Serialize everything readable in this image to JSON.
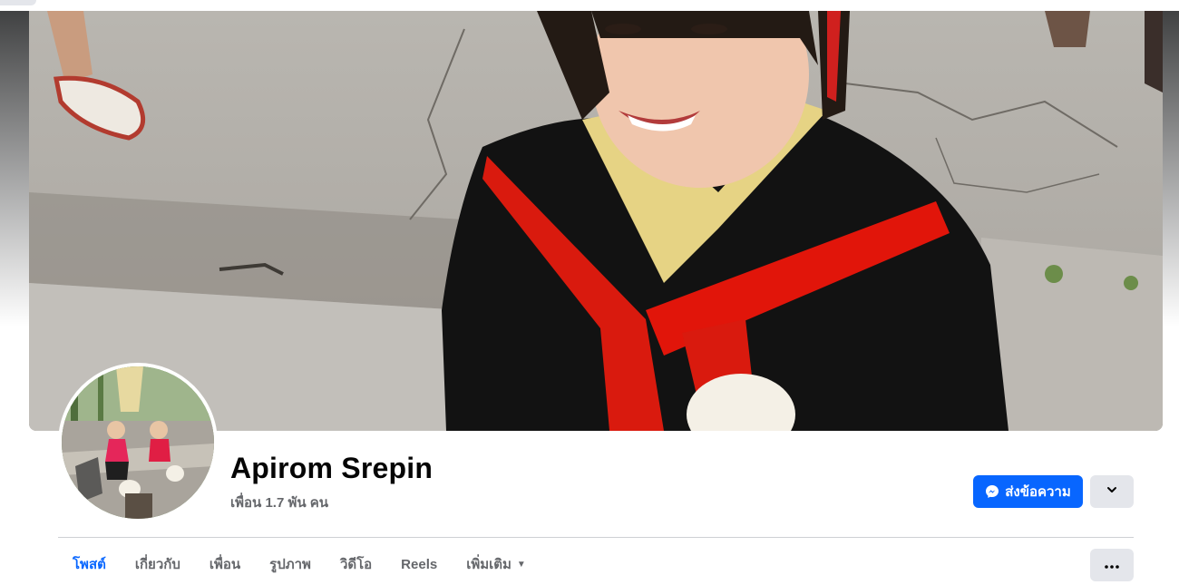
{
  "profile": {
    "name": "Apirom Srepin",
    "friends_text": "เพื่อน 1.7 พัน คน"
  },
  "actions": {
    "message_label": "ส่งข้อความ",
    "message_icon": "messenger-icon",
    "more_icon": "chevron-down-icon",
    "options_icon": "more-horizontal-icon"
  },
  "tabs": [
    {
      "label": "โพสต์",
      "active": true
    },
    {
      "label": "เกี่ยวกับ",
      "active": false
    },
    {
      "label": "เพื่อน",
      "active": false
    },
    {
      "label": "รูปภาพ",
      "active": false
    },
    {
      "label": "วิดีโอ",
      "active": false
    },
    {
      "label": "Reels",
      "active": false
    },
    {
      "label": "เพิ่มเติม",
      "active": false,
      "has_caret": true
    }
  ],
  "colors": {
    "accent": "#0866ff",
    "button_gray": "#e4e6eb",
    "text_primary": "#050505",
    "text_secondary": "#65676b"
  }
}
